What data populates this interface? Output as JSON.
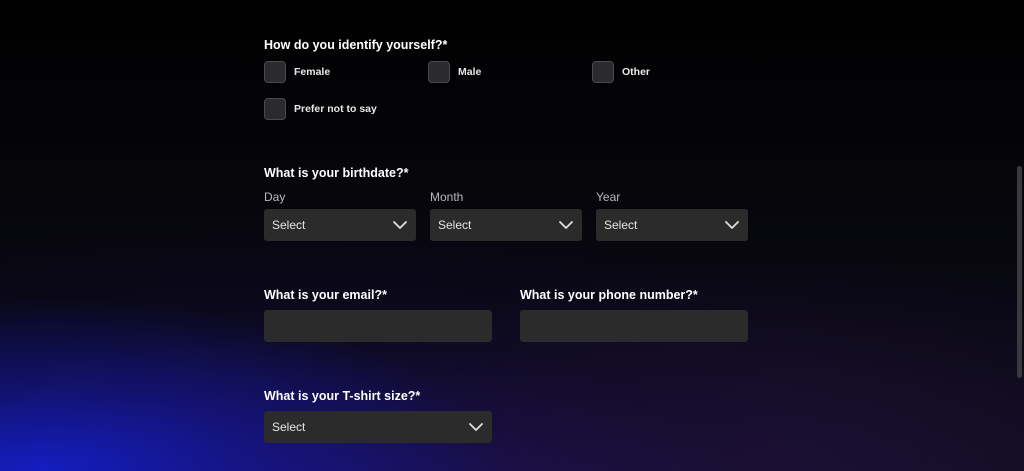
{
  "gender": {
    "question": "How do you identify yourself?*",
    "options": [
      "Female",
      "Male",
      "Other",
      "Prefer not to say"
    ]
  },
  "birthdate": {
    "question": "What is your birthdate?*",
    "day": {
      "label": "Day",
      "value": "Select"
    },
    "month": {
      "label": "Month",
      "value": "Select"
    },
    "year": {
      "label": "Year",
      "value": "Select"
    }
  },
  "email": {
    "question": "What is your email?*",
    "value": ""
  },
  "phone": {
    "question": "What is your phone number?*",
    "value": ""
  },
  "tshirt": {
    "question": "What is your T-shirt size?*",
    "value": "Select"
  },
  "icons": {
    "select_arrow": "chevron-down-icon",
    "checkbox": "checkbox-unchecked"
  }
}
